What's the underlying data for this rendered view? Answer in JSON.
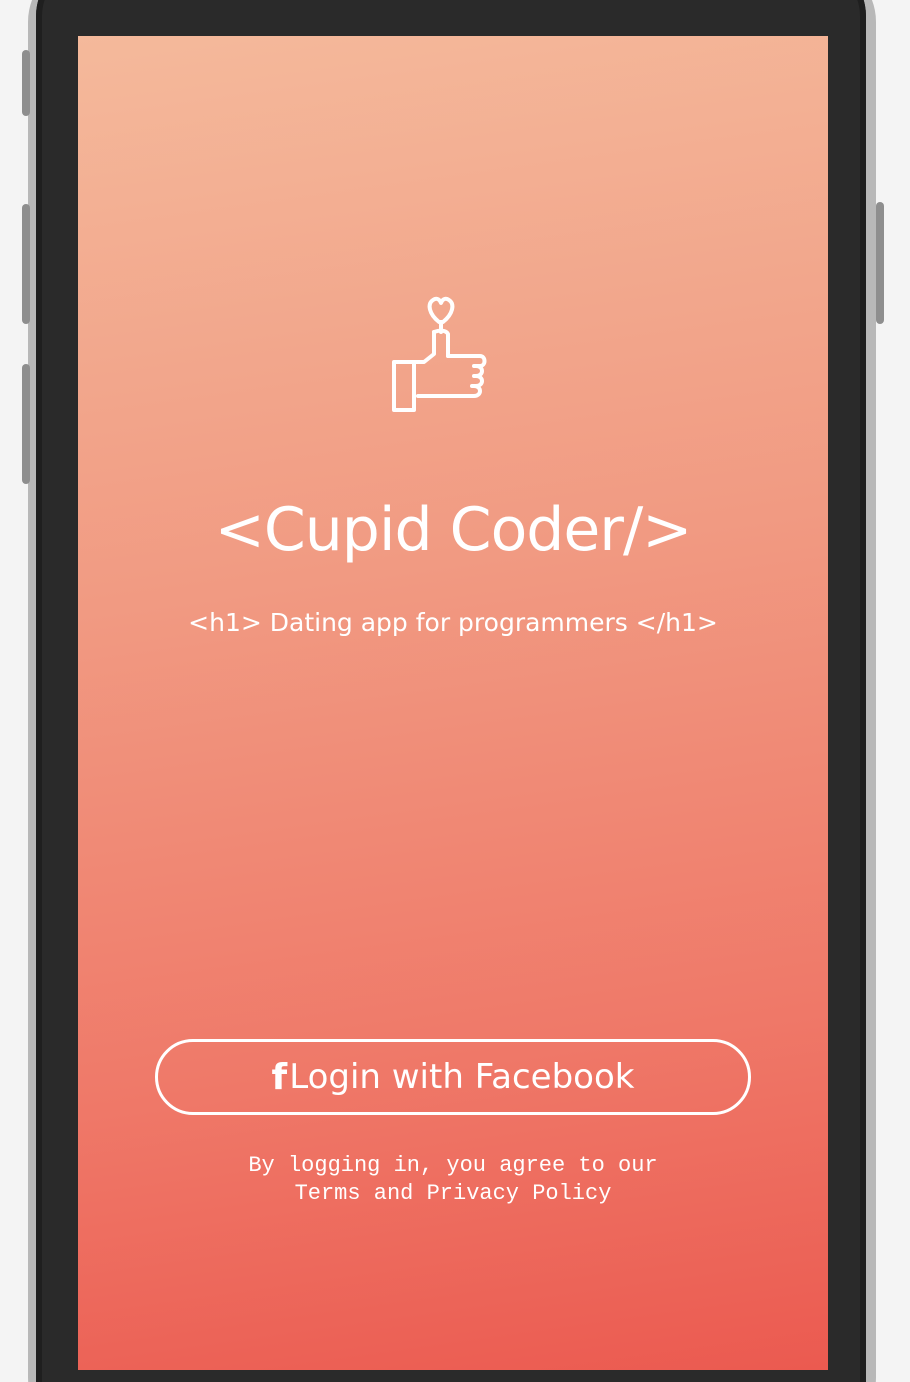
{
  "app": {
    "title": "<Cupid Coder/>",
    "subtitle": "<h1> Dating app for programmers </h1>"
  },
  "login": {
    "icon": "facebook-icon",
    "icon_glyph": "f",
    "label": "Login with Facebook"
  },
  "legal": {
    "line1": "By logging in, you agree to our",
    "line2": "Terms and Privacy Policy"
  },
  "colors": {
    "gradient_top": "#f4b99b",
    "gradient_bottom": "#eb5a50",
    "foreground": "#ffffff",
    "phone_frame": "#2a2a2a"
  }
}
